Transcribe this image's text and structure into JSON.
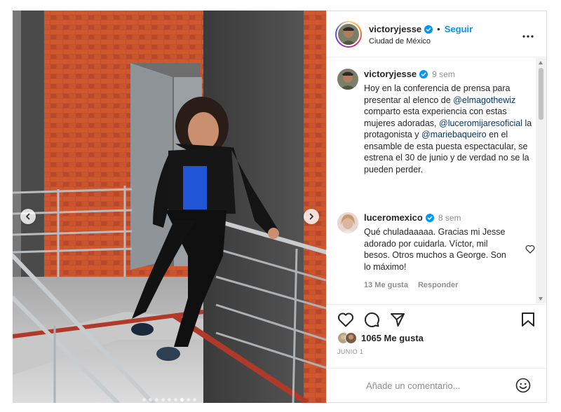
{
  "carousel": {
    "slide_count": 9,
    "active_slide": 6
  },
  "header": {
    "username": "victoryjesse",
    "follow_label": "Seguir",
    "separator": "•",
    "location": "Ciudad de México"
  },
  "caption": {
    "username": "victoryjesse",
    "time": "9 sem",
    "text_1": "Hoy en la conferencia de prensa para presentar al elenco de ",
    "mention_1": "@elmagothewiz",
    "text_2": " comparto esta experiencia con estas mujeres adoradas, ",
    "mention_2": "@luceromijaresoficial",
    "text_3": " la protagonista y ",
    "mention_3": "@mariebaqueiro",
    "text_4": " en el ensamble de esta puesta espectacular, se estrena el 30 de junio y de verdad no se la pueden perder."
  },
  "comment": {
    "username": "luceromexico",
    "time": "8 sem",
    "text": "Qué chuladaaaaa. Gracias mi Jesse adorado por cuidarla. Víctor, mil besos. Otros muchos a George. Son lo máximo!",
    "likes": "13 Me gusta",
    "reply_label": "Responder"
  },
  "post": {
    "likes": "1065 Me gusta",
    "date": "JUNIO 1"
  },
  "add_comment": {
    "placeholder": "Añade un comentario..."
  },
  "colors": {
    "accent": "#0095f6",
    "verified": "#0095f6",
    "mention": "#00376b",
    "muted": "#8e8e8e"
  },
  "icons": {
    "verified": "verified-badge-icon",
    "more": "more-options-icon",
    "like": "heart-icon",
    "comment": "comment-icon",
    "share": "paper-plane-icon",
    "save": "bookmark-icon",
    "emoji": "emoji-icon",
    "prev": "chevron-left-icon",
    "next": "chevron-right-icon"
  }
}
